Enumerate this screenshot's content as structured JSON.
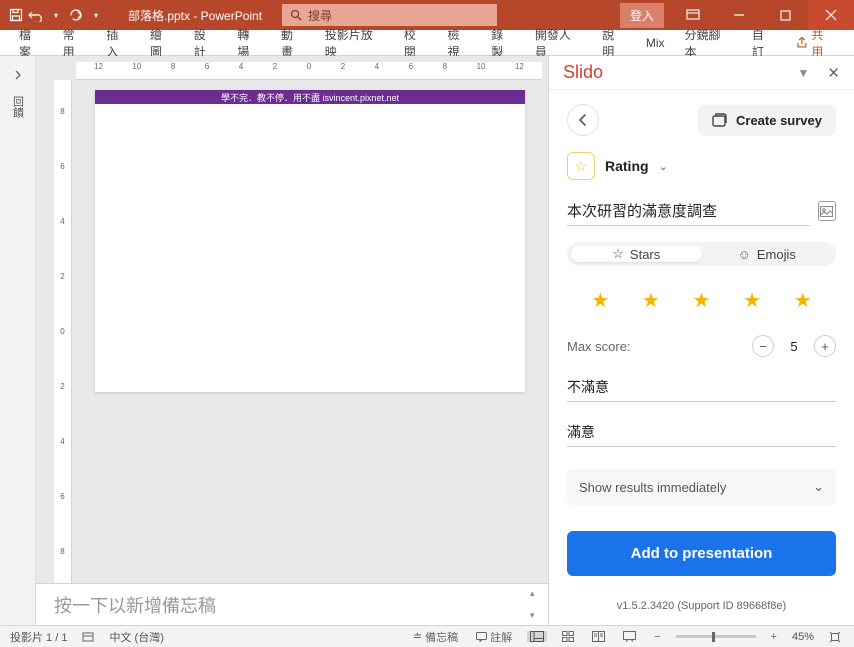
{
  "titlebar": {
    "doc_title": "部落格.pptx - PowerPoint",
    "search_placeholder": "搜尋",
    "login": "登入"
  },
  "ribbon": {
    "tabs": [
      "檔案",
      "常用",
      "插入",
      "繪圖",
      "設計",
      "轉場",
      "動畫",
      "投影片放映",
      "校閱",
      "檢視",
      "錄製",
      "開發人員",
      "說明",
      "Mix",
      "分鏡腳本",
      "自訂"
    ],
    "share": "共用"
  },
  "leftnav": {
    "label": "回饋"
  },
  "ruler_h": [
    "12",
    "10",
    "8",
    "6",
    "4",
    "2",
    "0",
    "2",
    "4",
    "6",
    "8",
    "10",
    "12"
  ],
  "ruler_v": [
    "8",
    "6",
    "4",
    "2",
    "0",
    "2",
    "4",
    "6",
    "8"
  ],
  "slide": {
    "banner": "學不完．教不停．用不盡 isvincent.pixnet.net"
  },
  "notes": {
    "placeholder": "按一下以新增備忘稿"
  },
  "slido": {
    "brand": "Slido",
    "create_survey": "Create survey",
    "type_label": "Rating",
    "title_value": "本次研習的滿意度調查",
    "toggle_stars": "Stars",
    "toggle_emojis": "Emojis",
    "maxscore_label": "Max score:",
    "maxscore_value": "5",
    "low_label": "不滿意",
    "high_label": "滿意",
    "results_label": "Show results immediately",
    "add_button": "Add to presentation",
    "version": "v1.5.2.3420 (Support ID 89668f8e)"
  },
  "statusbar": {
    "slide_of": "投影片 1 / 1",
    "lang": "中文 (台灣)",
    "notes_btn": "備忘稿",
    "comments_btn": "註解",
    "zoom": "45%"
  }
}
